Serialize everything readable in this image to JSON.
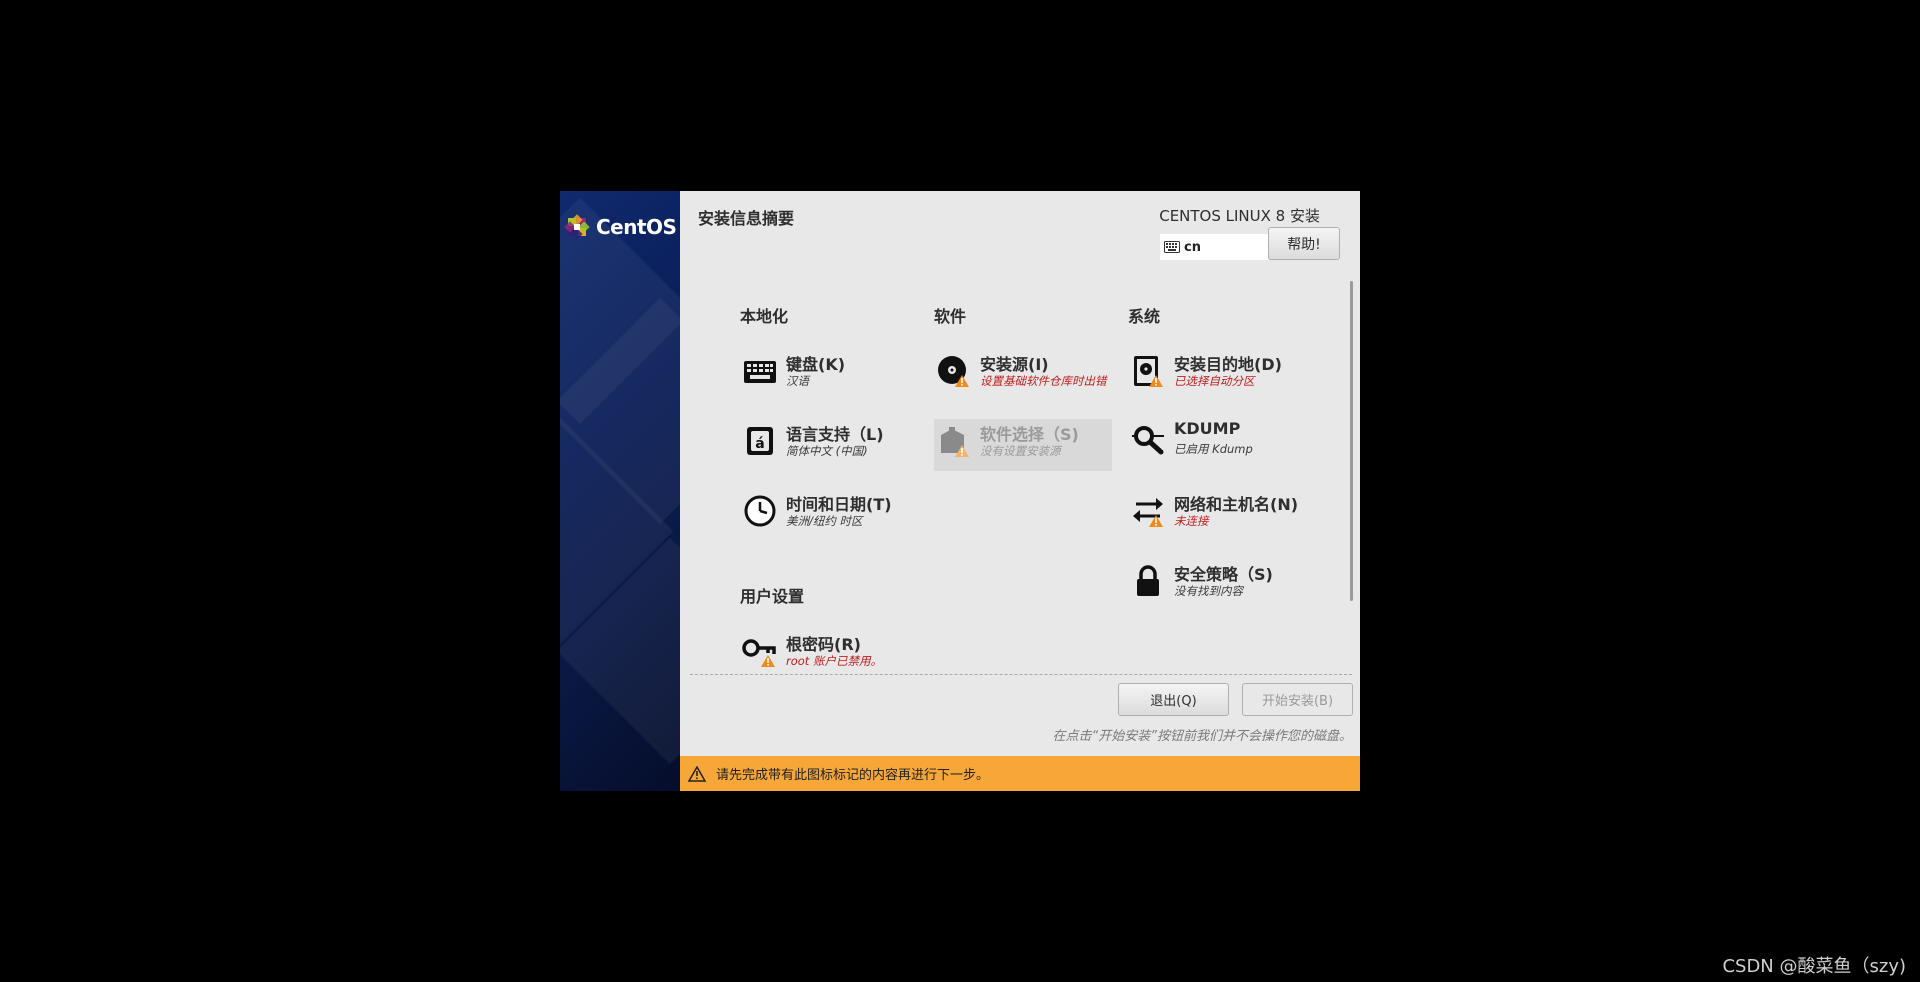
{
  "header": {
    "title": "安装信息摘要",
    "product": "CENTOS LINUX 8 安装",
    "keyboard_layout": "cn",
    "help_button": "帮助!"
  },
  "sidebar": {
    "logo_text": "CentOS"
  },
  "sections": {
    "localization": "本地化",
    "software": "软件",
    "system": "系统",
    "user": "用户设置"
  },
  "spokes": {
    "keyboard": {
      "label": "键盘(K)",
      "status": "汉语",
      "icon": "keyboard-icon"
    },
    "language": {
      "label": "语言支持（L)",
      "status": "简体中文 (中国)",
      "icon": "language-icon"
    },
    "time": {
      "label": "时间和日期(T)",
      "status": "美洲/纽约 时区",
      "icon": "clock-icon"
    },
    "source": {
      "label": "安装源(I)",
      "status": "设置基础软件仓库时出错",
      "icon": "disc-warning-icon"
    },
    "software_selection": {
      "label": "软件选择（S)",
      "status": "没有设置安装源",
      "icon": "package-warning-icon"
    },
    "destination": {
      "label": "安装目的地(D)",
      "status": "已选择自动分区",
      "icon": "harddisk-warning-icon"
    },
    "kdump": {
      "label": "KDUMP",
      "status": "已启用 Kdump",
      "icon": "magnifier-icon"
    },
    "network": {
      "label": "网络和主机名(N)",
      "status": "未连接",
      "icon": "network-warning-icon"
    },
    "security": {
      "label": "安全策略（S)",
      "status": "没有找到内容",
      "icon": "lock-icon"
    },
    "root": {
      "label": "根密码(R)",
      "status": "root 账户已禁用。",
      "icon": "key-warning-icon"
    }
  },
  "buttons": {
    "quit": "退出(Q)",
    "begin": "开始安装(B)"
  },
  "note": "在点击“开始安装”按钮前我们并不会操作您的磁盘。",
  "warning_bar": "请先完成带有此图标标记的内容再进行下一步。",
  "watermark": "CSDN @酸菜鱼（szy)",
  "colors": {
    "warning": "#f7a738",
    "error_text": "#c01c1c",
    "sidebar": "#0b1b4a"
  }
}
